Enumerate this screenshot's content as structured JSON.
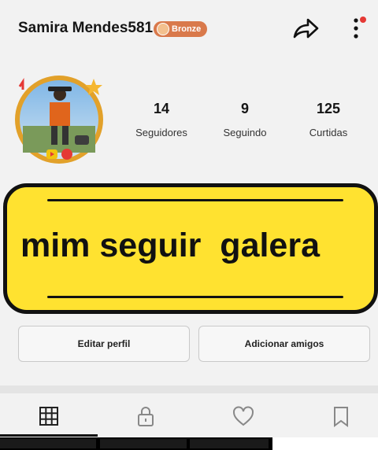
{
  "header": {
    "username": "Samira Mendes581",
    "badge_label": "Bronze",
    "share_icon": "share-arrow-icon",
    "more_icon": "more-vertical-icon",
    "notification_color": "#e53935"
  },
  "profile": {
    "avatar_icon": "profile-avatar-icon",
    "stats": [
      {
        "value": "14",
        "label": "Seguidores"
      },
      {
        "value": "9",
        "label": "Seguindo"
      },
      {
        "value": "125",
        "label": "Curtidas"
      }
    ]
  },
  "banner": {
    "text": "mim seguir  galera",
    "background": "#ffe230"
  },
  "actions": {
    "edit_profile": "Editar perfil",
    "add_friends": "Adicionar amigos"
  },
  "tabs": [
    {
      "icon": "grid-icon"
    },
    {
      "icon": "lock-icon"
    },
    {
      "icon": "heart-icon"
    },
    {
      "icon": "bookmark-icon"
    }
  ]
}
